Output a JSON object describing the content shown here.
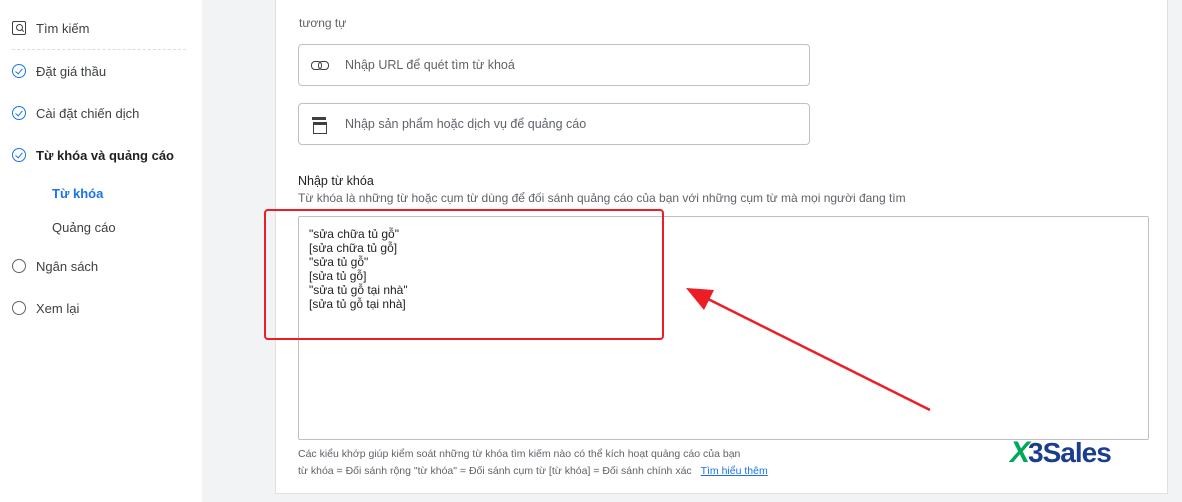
{
  "sidebar": {
    "items": [
      {
        "label": "Tìm kiếm",
        "icon": "search-icon",
        "state": "none"
      },
      {
        "label": "Đặt giá thầu",
        "icon": "check-circle-icon",
        "state": "done"
      },
      {
        "label": "Cài đặt chiến dịch",
        "icon": "check-circle-icon",
        "state": "done"
      },
      {
        "label": "Từ khóa và quảng cáo",
        "icon": "check-circle-icon",
        "state": "current"
      },
      {
        "label": "Ngân sách",
        "icon": "circle-icon",
        "state": "todo"
      },
      {
        "label": "Xem lại",
        "icon": "circle-icon",
        "state": "todo"
      }
    ],
    "subitems": [
      {
        "label": "Từ khóa",
        "active": true
      },
      {
        "label": "Quảng cáo",
        "active": false
      }
    ]
  },
  "main": {
    "tail_text": "tương tự",
    "url_input": {
      "placeholder": "Nhập URL để quét tìm từ khoá",
      "icon": "link-icon"
    },
    "product_input": {
      "placeholder": "Nhập sản phẩm hoặc dịch vụ để quảng cáo",
      "icon": "store-icon"
    },
    "keywords_title": "Nhập từ khóa",
    "keywords_desc": "Từ khóa là những từ hoặc cụm từ dùng để đối sánh quảng cáo của bạn với những cụm từ mà mọi người đang tìm",
    "keywords": [
      "\"sửa chữa tủ gỗ\"",
      "[sửa chữa tủ gỗ]",
      "\"sửa tủ gỗ\"",
      "[sửa tủ gỗ]",
      "\"sửa tủ gỗ tại nhà\"",
      "[sửa tủ gỗ tại nhà]"
    ],
    "footer_line1": "Các kiểu khớp giúp kiểm soát những từ khóa tìm kiếm nào có thể kích hoạt quảng cáo của bạn",
    "footer_line2": "từ khóa = Đối sánh rộng  \"từ khóa\" = Đối sánh cụm từ  [từ khóa] = Đối sánh chính xác",
    "learn_more": "Tìm hiểu thêm"
  },
  "logo": {
    "mark": "X",
    "text": "3Sales",
    "colors": {
      "mark": "#00a859",
      "text": "#1b3d8f"
    }
  },
  "annotation_color": "#ec1d24",
  "accent": "#1a73e8"
}
